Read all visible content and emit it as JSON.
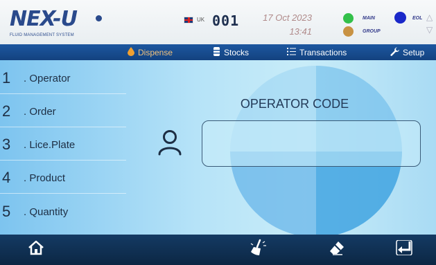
{
  "header": {
    "logo_text": "NEX-U",
    "logo_subtitle": "FLUID MANAGEMENT SYSTEM",
    "language": "UK",
    "device_number": "001",
    "date": "17 Oct 2023",
    "time": "13:41",
    "indicators": [
      {
        "label": "MAIN",
        "color": "#33c04a"
      },
      {
        "label": "GROUP",
        "color": "#c89243"
      },
      {
        "label": "EOL",
        "color": "#1a28c9"
      }
    ]
  },
  "nav": {
    "tabs": [
      {
        "label": "Dispense",
        "icon": "drop-icon",
        "active": true
      },
      {
        "label": "Stocks",
        "icon": "barrel-icon"
      },
      {
        "label": "Transactions",
        "icon": "list-icon"
      },
      {
        "label": "Setup",
        "icon": "wrench-icon"
      }
    ]
  },
  "fields": [
    {
      "num": "1",
      "label": ". Operator"
    },
    {
      "num": "2",
      "label": ". Order"
    },
    {
      "num": "3",
      "label": ". Lice.Plate"
    },
    {
      "num": "4",
      "label": ". Product"
    },
    {
      "num": "5",
      "label": ". Quantity"
    }
  ],
  "main": {
    "prompt": "OPERATOR CODE",
    "code_value": "",
    "user_icon": "user-icon"
  },
  "bottom": {
    "buttons": [
      "home-icon",
      "brush-icon",
      "eraser-icon",
      "enter-icon"
    ]
  },
  "colors": {
    "nav_bg": "#1d57a0",
    "active_tab": "#f1c27d",
    "main_status": "#33c04a",
    "group_status": "#c89243",
    "eol_status": "#1a28c9"
  }
}
